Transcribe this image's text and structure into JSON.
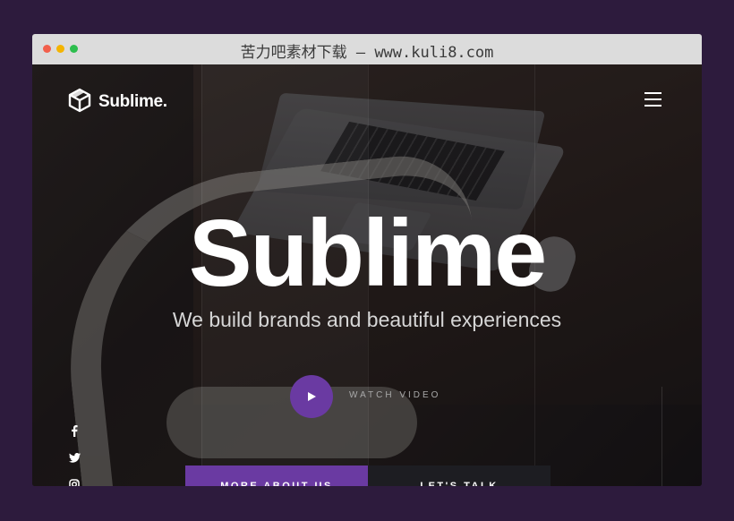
{
  "browser": {
    "title": "苦力吧素材下载 – www.kuli8.com",
    "dots": {
      "red": "#f25f4c",
      "yellow": "#f4b400",
      "green": "#2dbe4e"
    }
  },
  "header": {
    "logo_text": "Sublime.",
    "logo_icon": "cube-icon",
    "menu_icon": "hamburger-icon"
  },
  "hero": {
    "title": "Sublime",
    "subtitle": "We build brands and beautiful experiences",
    "watch_label": "WATCH VIDEO",
    "play_icon": "play-icon"
  },
  "social": [
    {
      "name": "facebook-icon",
      "glyph": "f"
    },
    {
      "name": "twitter-icon",
      "glyph": "t"
    },
    {
      "name": "instagram-icon",
      "glyph": "i"
    }
  ],
  "buttons": {
    "primary": "MORE ABOUT US",
    "secondary": "LET'S TALK"
  },
  "colors": {
    "accent": "#6a3aa2",
    "background": "#2d1b3d"
  }
}
